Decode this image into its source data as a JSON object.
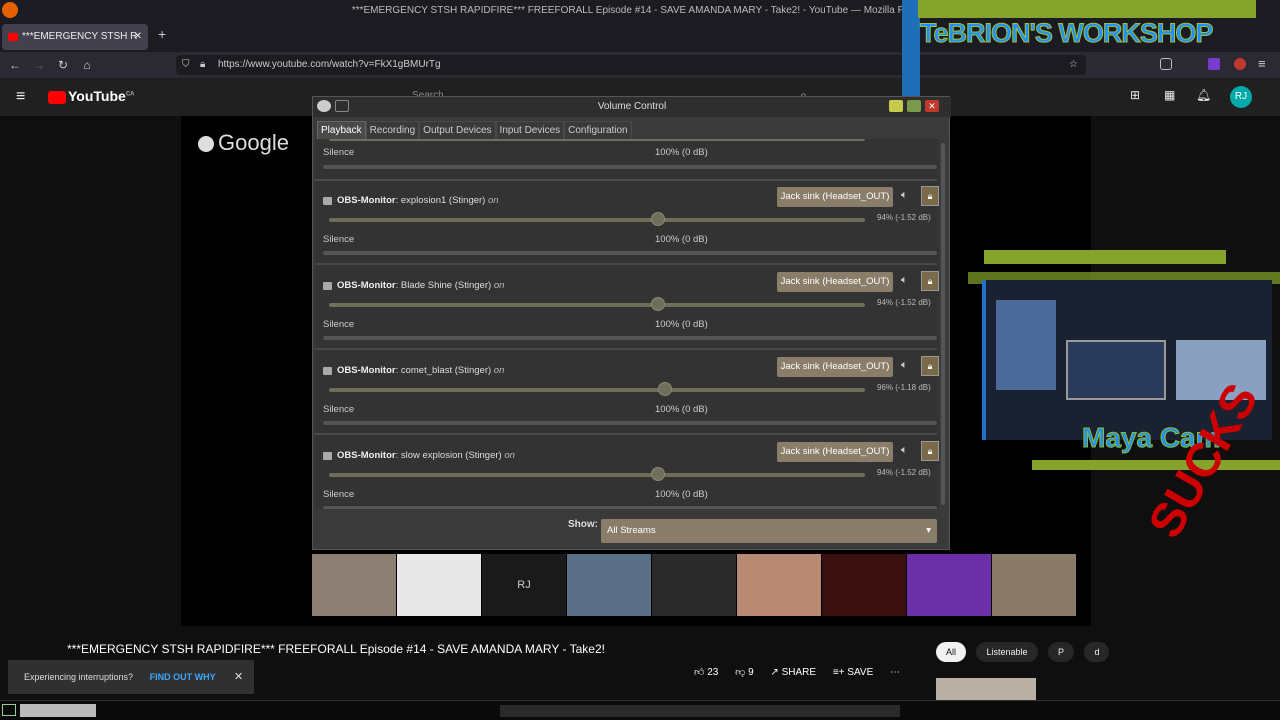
{
  "browser": {
    "window_title": "***EMERGENCY STSH RAPIDFIRE*** FREEFORALL Episode #14 - SAVE AMANDA MARY - Take2! - YouTube — Mozilla Firefox",
    "tab_title": "***EMERGENCY STSH R",
    "url": "https://www.youtube.com/watch?v=FkX1gBMUrTg"
  },
  "youtube": {
    "logo": "YouTube",
    "region": "CA",
    "search_placeholder": "Search",
    "avatar": "RJ",
    "player_watermark": "Google",
    "thumb_initials": "RJ",
    "video_title": "***EMERGENCY STSH RAPIDFIRE*** FREEFORALL Episode #14 - SAVE AMANDA MARY - Take2!",
    "toast_text": "Experiencing interruptions?",
    "toast_action": "FIND OUT WHY",
    "likes": "23",
    "comments": "9",
    "share": "SHARE",
    "save": "SAVE",
    "chips": [
      "All",
      "Listenable",
      "P",
      "d"
    ]
  },
  "overlays": {
    "workshop": "TeBRION'S WORKSHOP",
    "maya_cam": "Maya Cam",
    "sucks": "SUCKS"
  },
  "volume_control": {
    "title": "Volume Control",
    "tabs": [
      "Playback",
      "Recording",
      "Output Devices",
      "Input Devices",
      "Configuration"
    ],
    "active_tab": "Playback",
    "top_row": {
      "silence": "Silence",
      "level": "100% (0 dB)"
    },
    "streams": [
      {
        "app": "OBS-Monitor",
        "name": ": explosion1 (Stinger)",
        "on": "on",
        "sink": "Jack sink (Headset_OUT)",
        "percent": "94% (-1.52 dB)",
        "volume": 0.94,
        "silence": "Silence",
        "level": "100% (0 dB)"
      },
      {
        "app": "OBS-Monitor",
        "name": ": Blade Shine (Stinger)",
        "on": "on",
        "sink": "Jack sink (Headset_OUT)",
        "percent": "94% (-1.52 dB)",
        "volume": 0.94,
        "silence": "Silence",
        "level": "100% (0 dB)"
      },
      {
        "app": "OBS-Monitor",
        "name": ": comet_blast (Stinger)",
        "on": "on",
        "sink": "Jack sink (Headset_OUT)",
        "percent": "96% (-1.18 dB)",
        "volume": 0.96,
        "silence": "Silence",
        "level": "100% (0 dB)"
      },
      {
        "app": "OBS-Monitor",
        "name": ": slow explosion (Stinger)",
        "on": "on",
        "sink": "Jack sink (Headset_OUT)",
        "percent": "94% (-1.52 dB)",
        "volume": 0.94,
        "silence": "Silence",
        "level": "100% (0 dB)"
      }
    ],
    "show_label": "Show:",
    "show_value": "All Streams"
  },
  "colors": {
    "accent_sink": "#8a7e6a",
    "youtube_red": "#ff0000",
    "link_blue": "#3ea6ff",
    "overlay_green": "#86a42b",
    "overlay_blue": "#1e90ff"
  }
}
